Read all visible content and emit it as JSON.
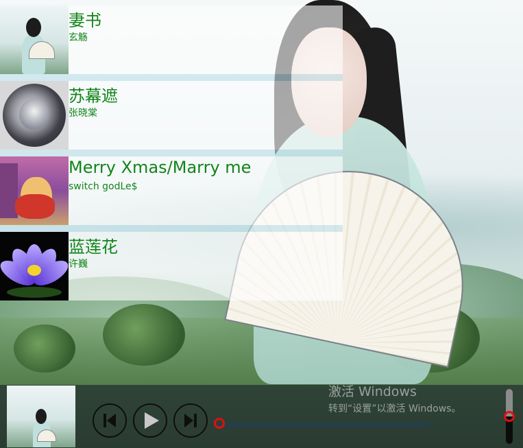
{
  "playlist": {
    "songs": [
      {
        "title": "妻书",
        "artist": "玄觞",
        "cover_icon": "girl-with-fan-thumbnail"
      },
      {
        "title": "苏幕遮",
        "artist": "张晓棠",
        "cover_icon": "circular-ink-art-thumbnail"
      },
      {
        "title": "Merry Xmas/Marry me",
        "artist": "switch godLe$",
        "cover_icon": "cartoon-cat-thumbnail"
      },
      {
        "title": "蓝莲花",
        "artist": "许巍",
        "cover_icon": "blue-lotus-thumbnail"
      }
    ]
  },
  "player": {
    "current_cover_icon": "girl-with-fan-cover",
    "progress_fraction": 0.0,
    "volume_fraction": 0.5
  },
  "watermark": {
    "title": "激活 Windows",
    "subtitle": "转到“设置”以激活 Windows。"
  },
  "colors": {
    "song_text": "#12841a",
    "knob": "#e01010",
    "player_bg": "#232d30"
  }
}
